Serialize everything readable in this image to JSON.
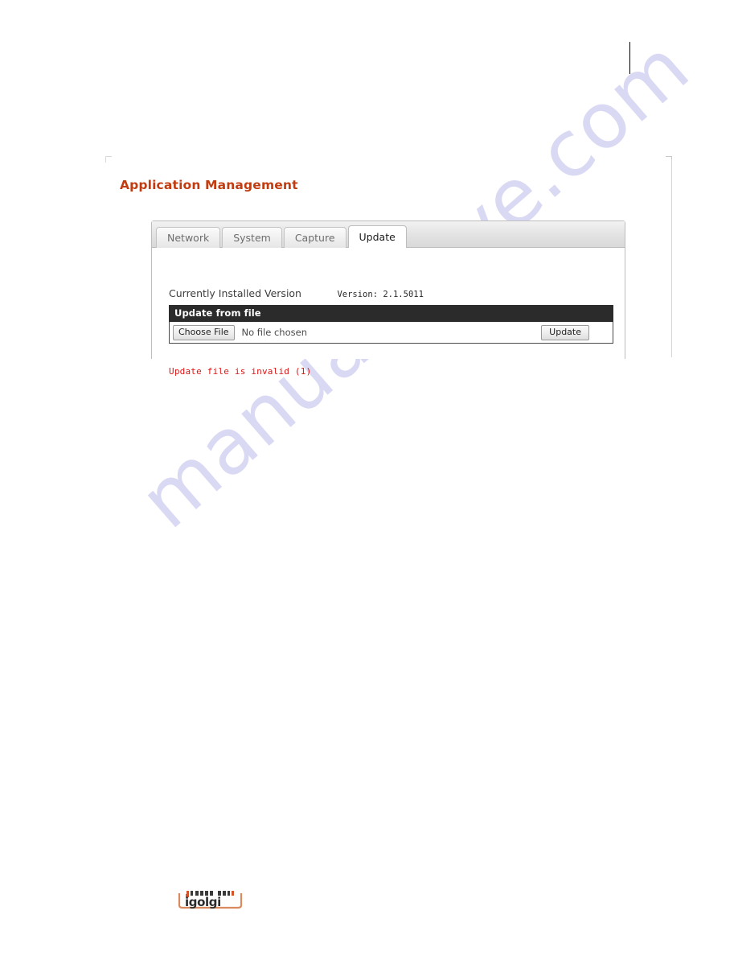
{
  "page": {
    "title": "Application Management",
    "title_color": "#c13c10",
    "watermark": "manualshive.com",
    "watermark_color": "#c3c3ee"
  },
  "panel": {
    "tabs": [
      {
        "label": "Network",
        "active": false
      },
      {
        "label": "System",
        "active": false
      },
      {
        "label": "Capture",
        "active": false
      },
      {
        "label": "Update",
        "active": true
      }
    ],
    "version": {
      "label": "Currently Installed Version",
      "value": "Version: 2.1.5011"
    },
    "update_from_file": {
      "header": "Update from file",
      "choose_file_label": "Choose File",
      "no_file_text": "No file chosen",
      "update_button_label": "Update"
    },
    "error": {
      "message": "Update file is invalid (1)",
      "color": "#e01414"
    }
  },
  "footer": {
    "logo_text": "igolgi",
    "logo_frame_color": "#d98a5e",
    "logo_text_color": "#2b2b2b",
    "logo_accent_color": "#d4542a"
  }
}
